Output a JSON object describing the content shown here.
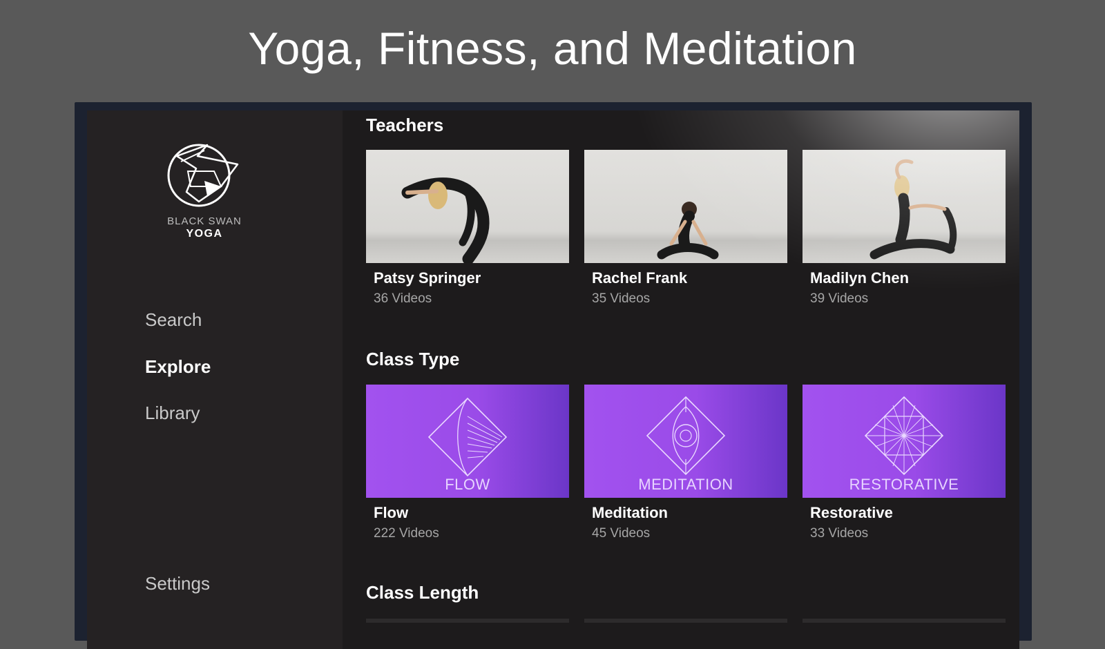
{
  "headline": "Yoga, Fitness, and Meditation",
  "brand": {
    "line1": "BLACK SWAN",
    "line2": "YOGA",
    "icon": "swan-logo-icon"
  },
  "nav": {
    "search": "Search",
    "explore": "Explore",
    "library": "Library",
    "settings": "Settings",
    "active": "Explore"
  },
  "sections": {
    "teachers": {
      "title": "Teachers",
      "items": [
        {
          "name": "Patsy Springer",
          "count": "36 Videos"
        },
        {
          "name": "Rachel Frank",
          "count": "35 Videos"
        },
        {
          "name": "Madilyn Chen",
          "count": "39 Videos"
        }
      ]
    },
    "class_type": {
      "title": "Class Type",
      "items": [
        {
          "name": "Flow",
          "count": "222 Videos",
          "badge": "FLOW"
        },
        {
          "name": "Meditation",
          "count": "45 Videos",
          "badge": "MEDITATION"
        },
        {
          "name": "Restorative",
          "count": "33 Videos",
          "badge": "RESTORATIVE"
        }
      ]
    },
    "class_length": {
      "title": "Class Length"
    }
  },
  "colors": {
    "background": "#595959",
    "sidebar": "#252223",
    "content": "#1d1b1c",
    "accent_purple": "#a252ef"
  }
}
